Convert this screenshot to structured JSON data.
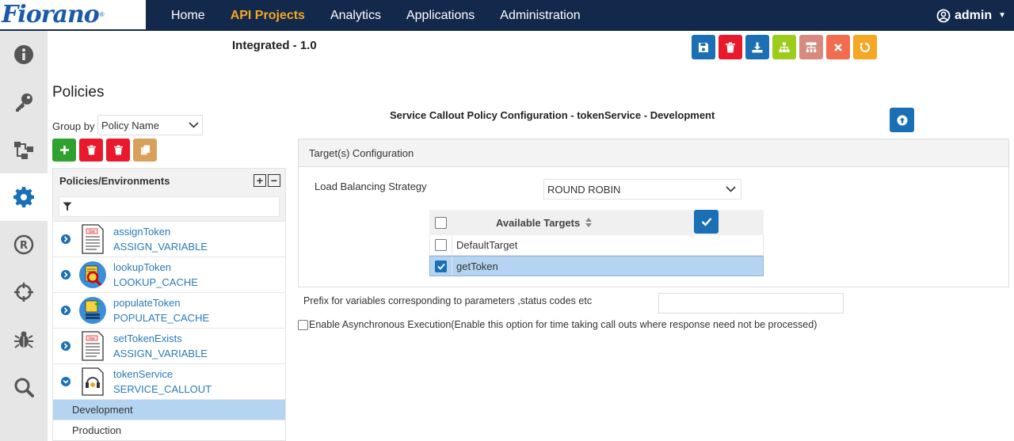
{
  "app": {
    "logo": "Fiorano"
  },
  "nav": {
    "items": [
      "Home",
      "API Projects",
      "Analytics",
      "Applications",
      "Administration"
    ],
    "active": "API Projects"
  },
  "user": {
    "name": "admin"
  },
  "sidebar": {
    "icons": [
      "info-icon",
      "key-icon",
      "flow-icon",
      "gear-icon",
      "registered-icon",
      "crosshair-icon",
      "bug-icon",
      "search-icon"
    ],
    "active": "gear-icon"
  },
  "project": {
    "title": "Integrated - 1.0"
  },
  "toolbar": {
    "buttons": [
      {
        "icon": "save-icon",
        "color": "#1a6fb5"
      },
      {
        "icon": "trash-icon",
        "color": "#e8192c"
      },
      {
        "icon": "download-icon",
        "color": "#1a6fb5"
      },
      {
        "icon": "sitemap-icon",
        "color": "#9ccc1c"
      },
      {
        "icon": "hierarchy-icon",
        "color": "#d88a80"
      },
      {
        "icon": "close-icon",
        "color": "#f26c4f"
      },
      {
        "icon": "refresh-icon",
        "color": "#f5a623"
      }
    ]
  },
  "policies": {
    "heading": "Policies",
    "group_by_label": "Group by",
    "group_by_value": "Policy Name",
    "tree_header": "Policies/Environments",
    "items": [
      {
        "name": "assignToken",
        "type": "ASSIGN_VARIABLE"
      },
      {
        "name": "lookupToken",
        "type": "LOOKUP_CACHE"
      },
      {
        "name": "populateToken",
        "type": "POPULATE_CACHE"
      },
      {
        "name": "setTokenExists",
        "type": "ASSIGN_VARIABLE"
      },
      {
        "name": "tokenService",
        "type": "SERVICE_CALLOUT"
      }
    ],
    "environments": [
      "Development",
      "Production"
    ],
    "selected_environment": "Development"
  },
  "config": {
    "title": "Service Callout Policy Configuration - tokenService - Development",
    "panel_title": "Target(s) Configuration",
    "lb_label": "Load Balancing Strategy",
    "lb_value": "ROUND ROBIN",
    "targets_header": "Available Targets",
    "targets": [
      {
        "name": "DefaultTarget",
        "checked": false
      },
      {
        "name": "getToken",
        "checked": true
      }
    ],
    "prefix_label": "Prefix for variables corresponding to parameters ,status codes etc",
    "prefix_value": "",
    "async_label": "Enable Asynchronous Execution(Enable this option for time taking call outs where response need not be processed)",
    "async_checked": false
  }
}
